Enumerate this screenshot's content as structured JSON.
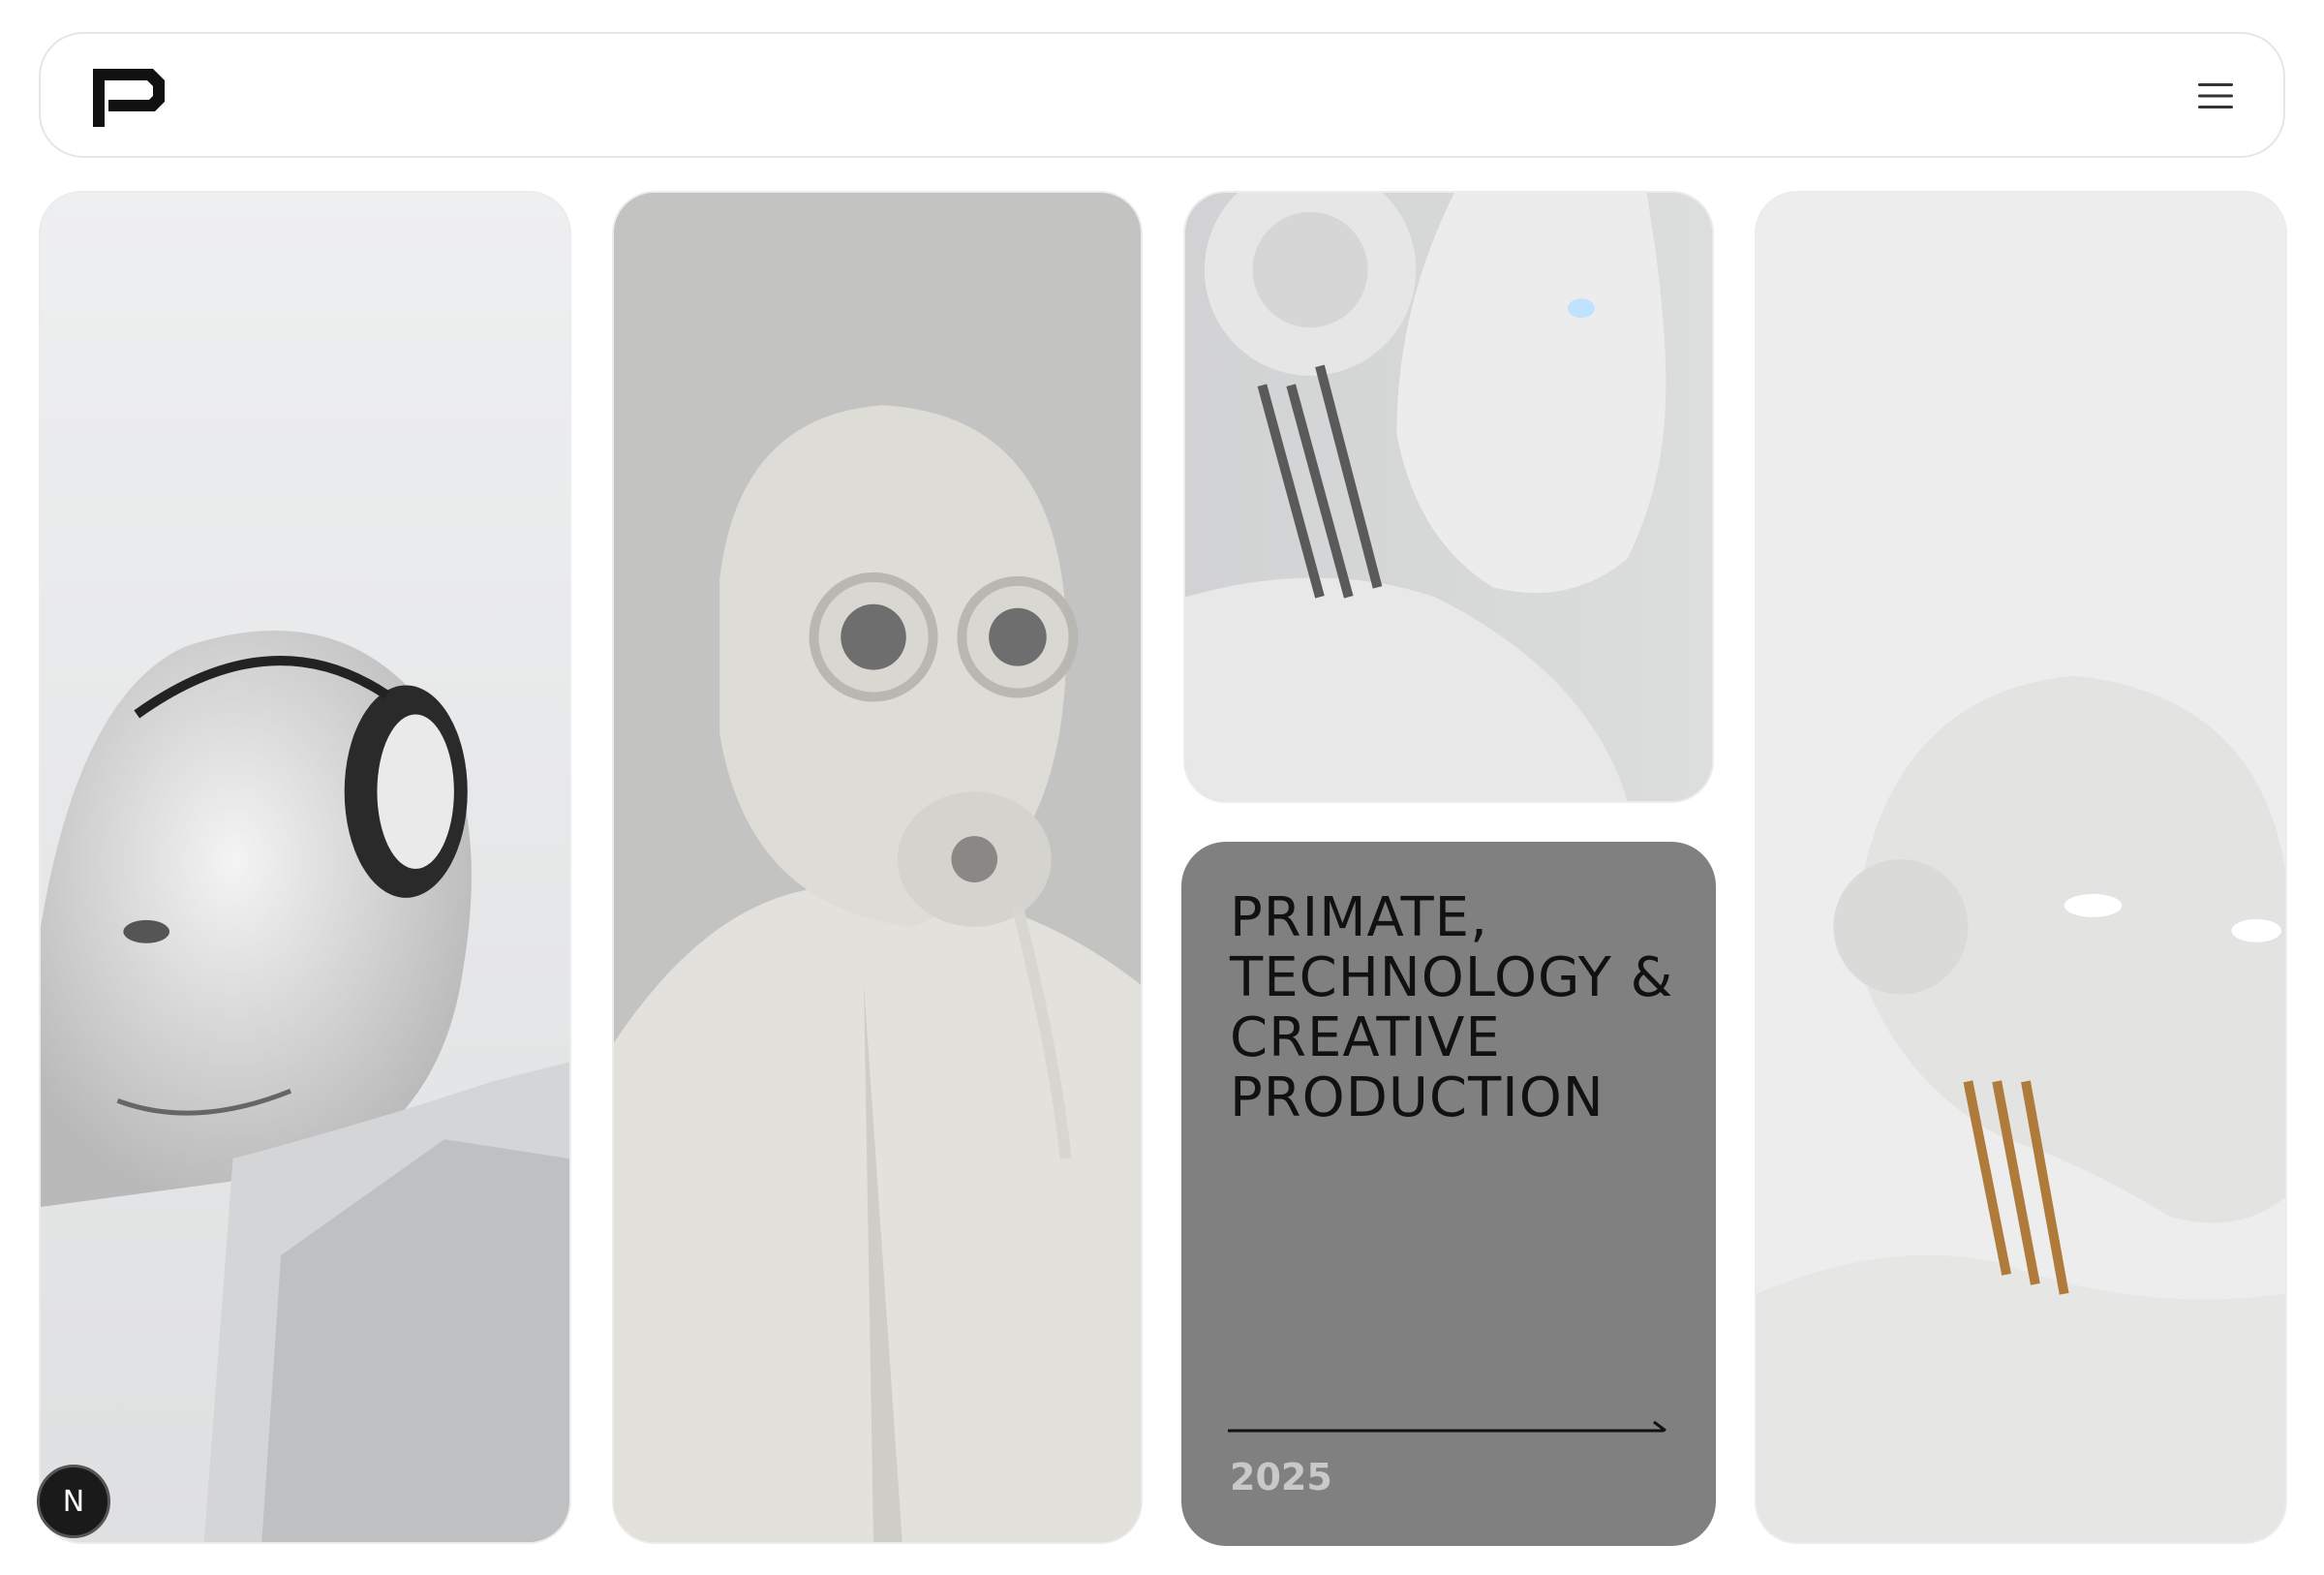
{
  "header": {
    "logo_icon": "brand-logo",
    "menu_icon": "hamburger-menu-icon"
  },
  "cards": [
    {
      "image": "primate-cyborg-with-headphones"
    },
    {
      "image": "figure-in-white-gas-mask-suit"
    },
    {
      "image": "robot-profile-side-view"
    },
    {
      "image": "humanoid-robot-glowing-eyes"
    }
  ],
  "feature_card": {
    "title": "PRIMATE, TECHNOLOGY & CREATIVE PRODUCTION",
    "year": "2025",
    "arrow_icon": "long-arrow-right-icon",
    "background": "#808080"
  },
  "badge": {
    "label": "N",
    "icon": "framework-dev-badge"
  }
}
